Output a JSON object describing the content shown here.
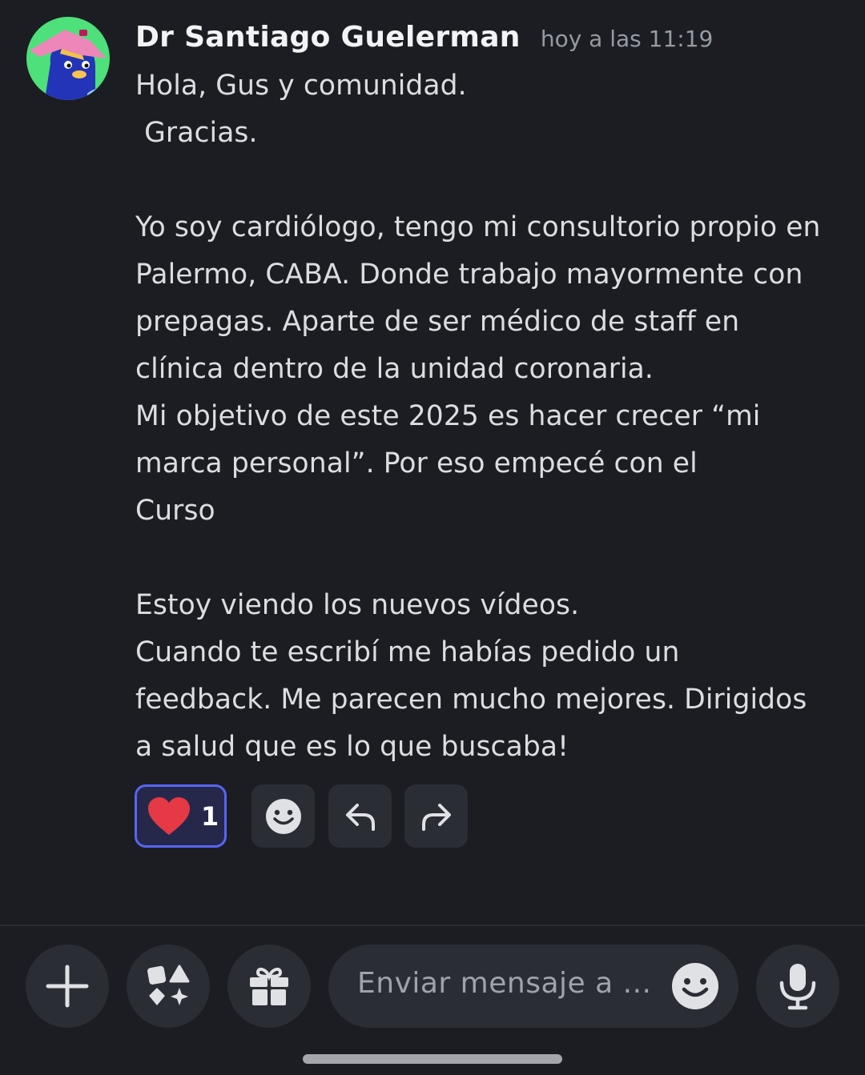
{
  "message": {
    "author": "Dr Santiago Guelerman",
    "timestamp": "hoy a las 11:19",
    "body": "Hola, Gus y comunidad.\n Gracias.\n\nYo soy cardiólogo, tengo mi consultorio propio en\nPalermo, CABA. Donde trabajo mayormente con\nprepagas. Aparte de ser médico de staff en\nclínica dentro de la unidad coronaria.\nMi objetivo de este 2025 es hacer crecer “mi\nmarca personal”. Por eso empecé con el\nCurso\n\nEstoy viendo los nuevos vídeos.\nCuando te escribí me habías pedido un\nfeedback. Me parecen mucho mejores. Dirigidos\na salud que es lo que buscaba!",
    "reaction": {
      "icon": "heart-icon",
      "count": "1",
      "color": "#e53945"
    },
    "actions": [
      {
        "name": "add-reaction-button",
        "icon": "smiley-icon"
      },
      {
        "name": "reply-button",
        "icon": "reply-arrow-icon"
      },
      {
        "name": "forward-button",
        "icon": "forward-arrow-icon"
      }
    ]
  },
  "composer": {
    "buttons": [
      {
        "name": "attach-button",
        "icon": "plus-icon"
      },
      {
        "name": "apps-button",
        "icon": "apps-shapes-icon"
      },
      {
        "name": "gift-button",
        "icon": "gift-icon"
      }
    ],
    "placeholder": "Enviar mensaje a ...",
    "emoji_icon": "smiley-icon",
    "voice_icon": "microphone-icon"
  },
  "theme": {
    "background": "#1c1d22",
    "surface": "#2b2d35",
    "accent": "#5865f2",
    "text": "#dbdee1",
    "muted": "#949ba4"
  }
}
